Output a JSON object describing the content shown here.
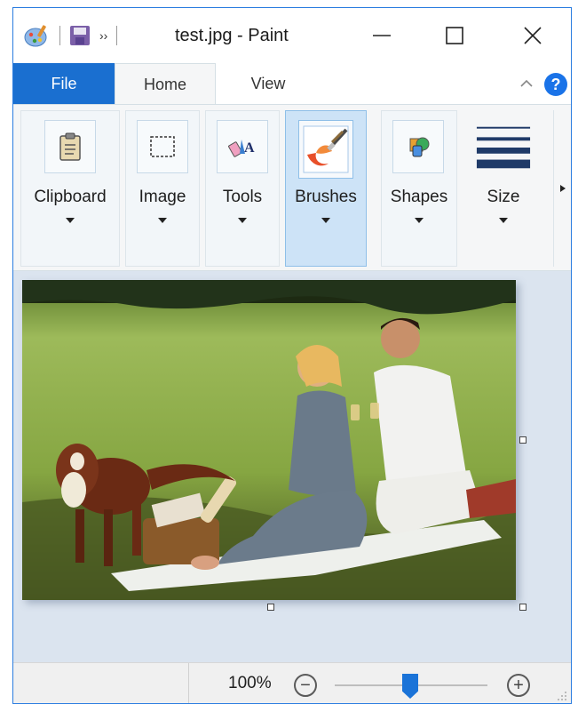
{
  "window": {
    "title": "test.jpg - Paint",
    "minimize_label": "—",
    "maximize_label": "☐",
    "close_label": "✕"
  },
  "qat": {
    "icons": [
      "paint-app-icon",
      "save-icon",
      "customize-qat-icon"
    ],
    "more_label": "››"
  },
  "tabs": {
    "file": "File",
    "home": "Home",
    "view": "View",
    "help": "?"
  },
  "ribbon": {
    "groups": [
      {
        "label": "Clipboard",
        "icon": "clipboard-icon"
      },
      {
        "label": "Image",
        "icon": "select-rectangle-icon"
      },
      {
        "label": "Tools",
        "icon": "tools-icon"
      },
      {
        "label": "Brushes",
        "icon": "brush-icon",
        "selected": true
      },
      {
        "label": "Shapes",
        "icon": "shapes-icon"
      },
      {
        "label": "Size",
        "icon": "line-size-icon"
      }
    ]
  },
  "canvas": {
    "image_description": "photo"
  },
  "status": {
    "zoom": "100%",
    "zoom_level": 1.0,
    "zoom_out_label": "−",
    "zoom_in_label": "+"
  },
  "colors": {
    "accent": "#1a6fd0",
    "canvas_bg": "#dbe4ef",
    "ribbon_bg": "#f5f6f7",
    "selected_group": "#cde3f7"
  }
}
